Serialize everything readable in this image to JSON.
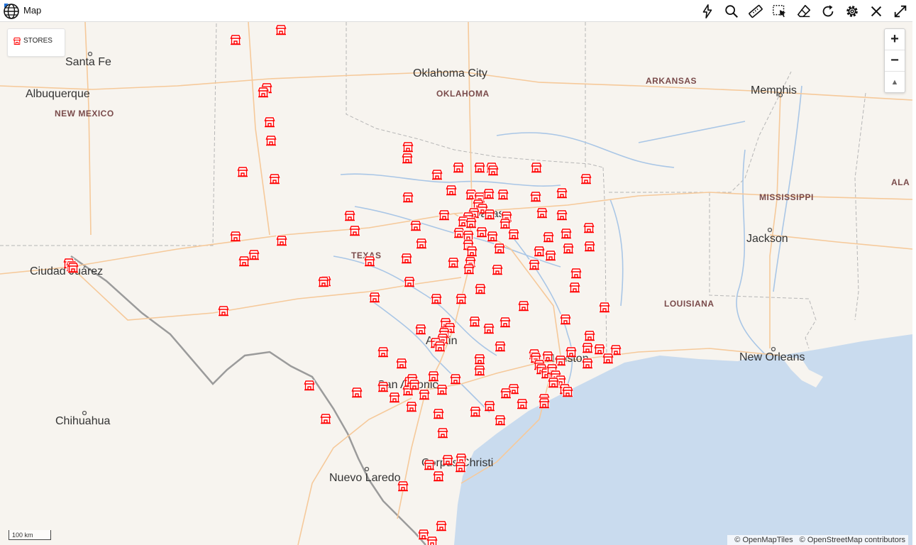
{
  "window": {
    "title": "Map"
  },
  "toolbar": {
    "tools": [
      {
        "icon": "lightning-icon"
      },
      {
        "icon": "search-icon"
      },
      {
        "icon": "ruler-icon"
      },
      {
        "icon": "select-area-icon"
      },
      {
        "icon": "eraser-icon"
      },
      {
        "icon": "refresh-icon"
      },
      {
        "icon": "settings-icon"
      },
      {
        "icon": "close-icon"
      },
      {
        "icon": "expand-icon"
      }
    ]
  },
  "legend": {
    "label": "STORES"
  },
  "zoom": {
    "in": "+",
    "out": "−",
    "north": "▲"
  },
  "scale": {
    "label": "100 km"
  },
  "attribution": {
    "tiles": "© OpenMapTiles",
    "osm": "© OpenStreetMap contributors"
  },
  "map": {
    "cities": {
      "santa_fe": "Santa Fe",
      "albuquerque": "Albuquerque",
      "oklahoma_city": "Oklahoma City",
      "memphis": "Memphis",
      "jackson": "Jackson",
      "ciudad_juarez": "Ciudad Juárez",
      "dallas": "Dallas",
      "austin": "Austin",
      "houston": "Houston",
      "san_antonio": "San Antonio",
      "new_orleans": "New Orleans",
      "chihuahua": "Chihuahua",
      "nuevo_laredo": "Nuevo Laredo",
      "corpus_christi": "Corpus Christi"
    },
    "states": {
      "new_mexico": "NEW MEXICO",
      "oklahoma": "OKLAHOMA",
      "arkansas": "ARKANSAS",
      "mississippi": "MISSISSIPPI",
      "louisiana": "LOUISIANA",
      "texas": "TEXAS",
      "alabama": "ALA"
    }
  },
  "colors": {
    "marker": "#ff0000",
    "water": "#c9dbee",
    "land": "#f7f4ef",
    "road": "#f6c99a",
    "river": "#a9c6e6"
  }
}
